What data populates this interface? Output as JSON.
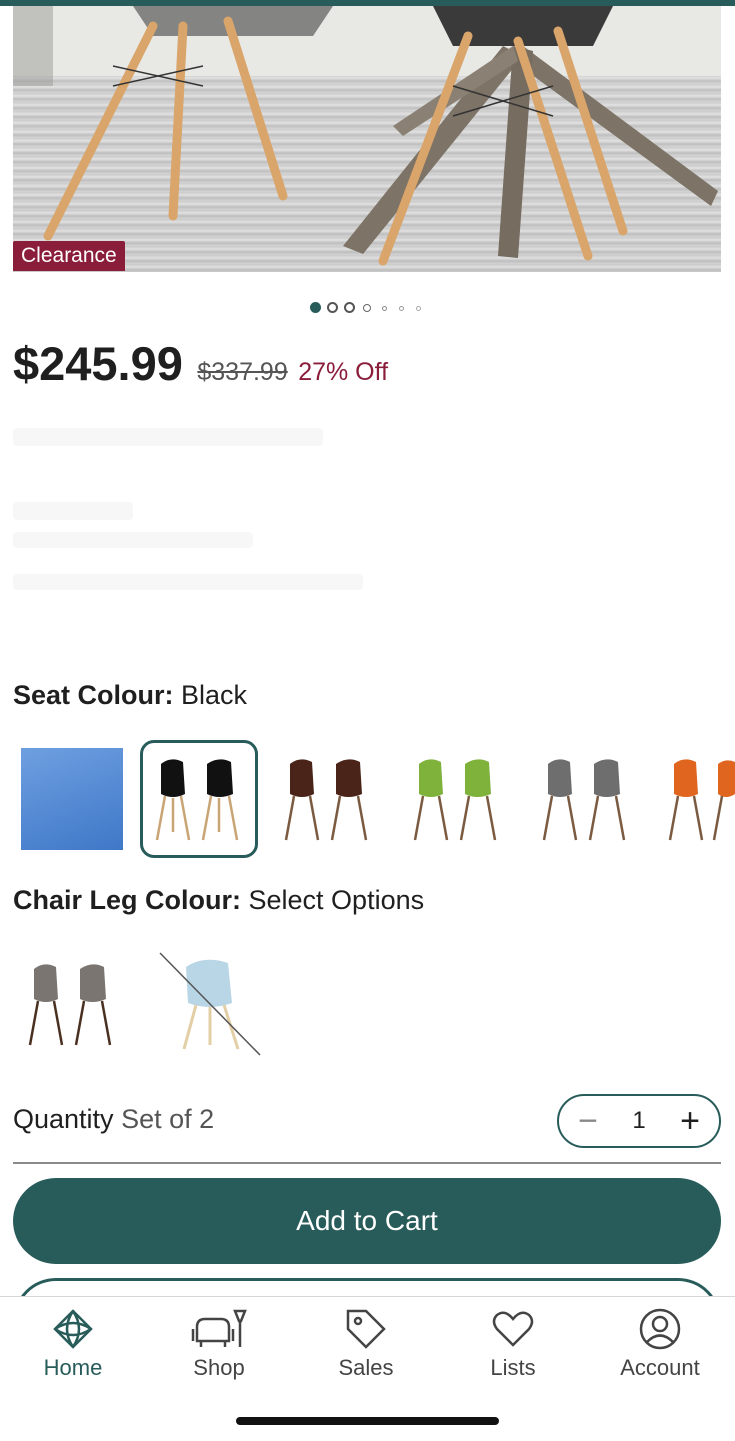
{
  "product": {
    "badge": "Clearance",
    "price": "$245.99",
    "original_price": "$337.99",
    "discount": "27% Off",
    "image_carousel": {
      "total_images": 7,
      "current_index": 1
    }
  },
  "seat_colour": {
    "label": "Seat Colour:",
    "selected": "Black",
    "options": [
      "Blue",
      "Black",
      "Brown",
      "Green",
      "Grey",
      "Orange"
    ]
  },
  "leg_colour": {
    "label": "Chair Leg Colour:",
    "selected": "Select Options",
    "options": [
      "Walnut",
      "Natural"
    ]
  },
  "quantity": {
    "label": "Quantity",
    "unit": "Set of 2",
    "value": "1",
    "minus": "−",
    "plus": "+"
  },
  "actions": {
    "add_to_cart": "Add to Cart"
  },
  "bottom_nav": [
    {
      "label": "Home",
      "icon": "home-icon",
      "active": true
    },
    {
      "label": "Shop",
      "icon": "shop-icon",
      "active": false
    },
    {
      "label": "Sales",
      "icon": "sales-tag-icon",
      "active": false
    },
    {
      "label": "Lists",
      "icon": "heart-icon",
      "active": false
    },
    {
      "label": "Account",
      "icon": "account-icon",
      "active": false
    }
  ],
  "colors": {
    "brand": "#285c5a",
    "sale": "#8a1d3a"
  }
}
